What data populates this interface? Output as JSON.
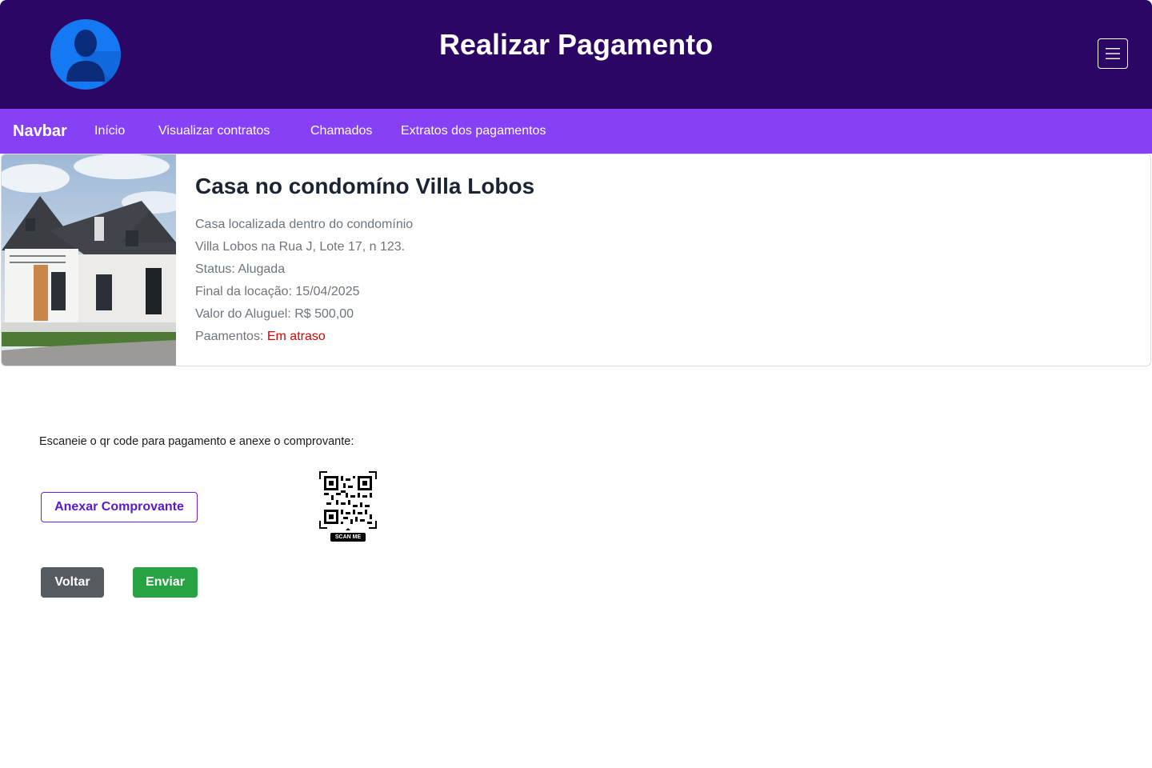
{
  "header": {
    "title": "Realizar Pagamento",
    "avatar_icon": "user-avatar-icon",
    "menu_icon": "hamburger-menu-icon",
    "colors": {
      "background": "#2c0664",
      "avatar": "#1479f2"
    }
  },
  "navbar": {
    "brand": "Navbar",
    "links": [
      "Início",
      "Visualizar contratos",
      "Chamados",
      "Extratos dos pagamentos"
    ],
    "color": "#8640f5"
  },
  "property": {
    "title": "Casa no condomíno Villa Lobos",
    "description_line1": "Casa localizada dentro do condomínio",
    "description_line2": "Villa Lobos na Rua J, Lote 17, n 123.",
    "status": "Status: Alugada",
    "lease_end": "Final da locação: 15/04/2025",
    "rent": "Valor do Aluguel: R$ 500,00",
    "payments_label": "Paamentos:",
    "payments_value": "Em atraso",
    "image_icon": "house-photo"
  },
  "payment": {
    "instruction": "Escaneie o qr code para pagamento e anexe o comprovante:",
    "attach_label": "Anexar Comprovante",
    "back_label": "Voltar",
    "send_label": "Enviar",
    "qr_caption": "SCAN ME",
    "colors": {
      "attach": "#6a1fe0",
      "back": "#565b60",
      "send": "#27a344",
      "late": "#e00000"
    }
  }
}
